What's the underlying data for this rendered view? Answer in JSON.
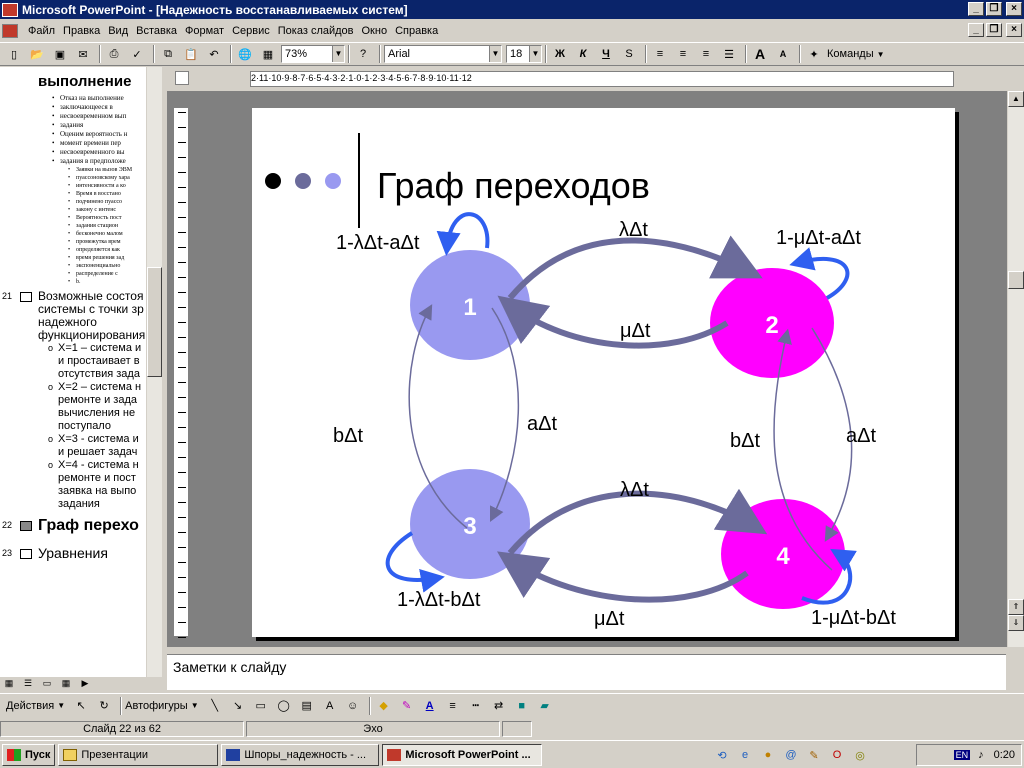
{
  "window": {
    "title": "Microsoft PowerPoint - [Надежность восстанавливаемых систем]"
  },
  "menu": [
    "Файл",
    "Правка",
    "Вид",
    "Вставка",
    "Формат",
    "Сервис",
    "Показ слайдов",
    "Окно",
    "Справка"
  ],
  "toolbar": {
    "zoom": "73%",
    "font": "Arial",
    "font_size": "18",
    "bold": "Ж",
    "italic": "К",
    "underline": "Ч",
    "commands": "Команды"
  },
  "outline": {
    "top_heading": "выполнение",
    "tiny_lines": [
      "Отказ на выполнение",
      "заключающееся в",
      "несвоевременном вып",
      "задания",
      "Оценим вероятность н",
      "момент времени пер",
      "несвоевременного вы",
      "задания в предположе"
    ],
    "micro_lines": [
      "Заявки на вызов ЭВМ",
      "пуассоновскому хара",
      "интенсивности a ко"
    ],
    "small_lines": [
      "Время в восстано",
      "подчинено пуассо",
      "закону с интенс",
      "Вероятность пост",
      "задания стацион",
      "бесконечно малом",
      "промежутка врем",
      "определяется как",
      "время решения зад",
      "экспоненциально",
      "распределение с",
      "b."
    ],
    "slide21": {
      "num": "21",
      "title_lines": [
        "Возможные состоя",
        "системы с точки зр",
        "надежного",
        "функционирования"
      ],
      "bullets": [
        [
          "X=1 – система и",
          "и простаивает в",
          "отсутствия зада"
        ],
        [
          "X=2 – система н",
          "ремонте и зада",
          "вычисления не",
          "поступало"
        ],
        [
          "X=3 - система и",
          "и решает задач"
        ],
        [
          "X=4  - система н",
          "ремонте и пост",
          "заявка на выпо",
          "задания"
        ]
      ]
    },
    "slide22": {
      "num": "22",
      "title": "Граф перехо"
    },
    "slide23": {
      "num": "23",
      "title": "Уравнения"
    }
  },
  "slide": {
    "title": "Граф переходов",
    "nodes": [
      "1",
      "2",
      "3",
      "4"
    ],
    "labels": {
      "loop1": "1-λΔt-aΔt",
      "loop2": "1-μΔt-aΔt",
      "loop3": "1-λΔt-bΔt",
      "loop4": "1-μΔt-bΔt",
      "e12": "λΔt",
      "e21": "μΔt",
      "e34": "λΔt",
      "e43": "μΔt",
      "e31": "bΔt",
      "e13": "aΔt",
      "e42": "bΔt",
      "e24": "aΔt"
    },
    "colors": {
      "blue_node": "#9999f0",
      "magenta_node": "#ff00ff",
      "arrow": "#6b6b9b",
      "loop_arrow": "#2f5ff0"
    }
  },
  "ruler_h": "2·11·10·9·8·7·6·5·4·3·2·1·0·1·2·3·4·5·6·7·8·9·10·11·12",
  "notes": {
    "placeholder": "Заметки к слайду"
  },
  "drawbar": {
    "actions": "Действия",
    "autoshapes": "Автофигуры"
  },
  "status": {
    "slide": "Слайд 22 из 62",
    "design": "Эхо"
  },
  "taskbar": {
    "start": "Пуск",
    "tasks": [
      "Презентации",
      "Шпоры_надежность - ...",
      "Microsoft PowerPoint ..."
    ],
    "lang": "EN",
    "time": "0:20"
  }
}
